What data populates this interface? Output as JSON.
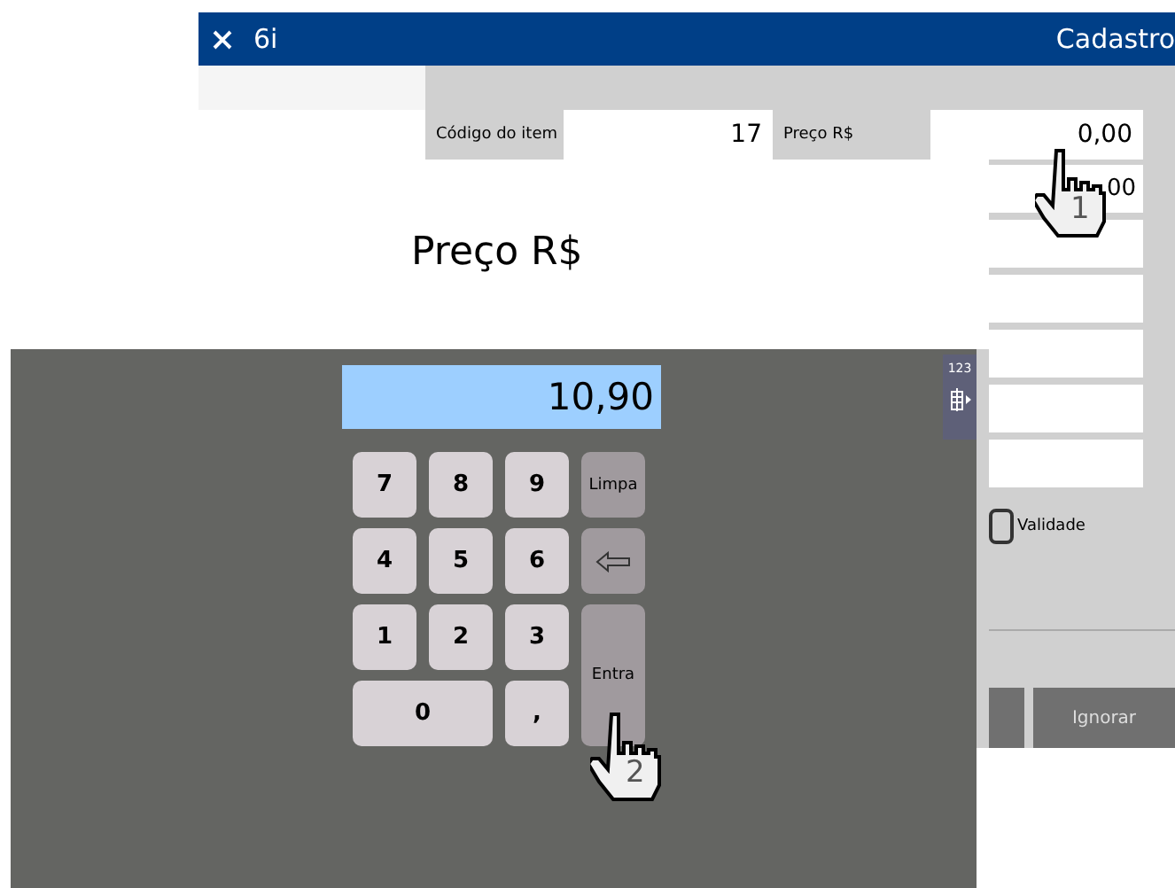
{
  "window": {
    "title": "6i",
    "heading": "Cadastro"
  },
  "form": {
    "fields": [
      {
        "label": "Código do item",
        "value": "17"
      },
      {
        "label": "Preço R$",
        "value": "0,00"
      }
    ],
    "side_field_value": "00",
    "checkbox": {
      "label": "Validade",
      "checked": false
    },
    "buttons": [
      "Ignorar"
    ]
  },
  "prompt": {
    "title": "Preço R$"
  },
  "keypad": {
    "display": "10,90",
    "side_tab": "123",
    "keys": [
      {
        "label": "7",
        "kind": "digit"
      },
      {
        "label": "8",
        "kind": "digit"
      },
      {
        "label": "9",
        "kind": "digit"
      },
      {
        "label": "Limpa",
        "kind": "clear"
      },
      {
        "label": "4",
        "kind": "digit"
      },
      {
        "label": "5",
        "kind": "digit"
      },
      {
        "label": "6",
        "kind": "digit"
      },
      {
        "kind": "backspace"
      },
      {
        "label": "1",
        "kind": "digit"
      },
      {
        "label": "2",
        "kind": "digit"
      },
      {
        "label": "3",
        "kind": "digit"
      },
      {
        "label": "Entra",
        "kind": "enter"
      },
      {
        "label": "0",
        "kind": "wide"
      },
      {
        "label": ",",
        "kind": "digit"
      }
    ]
  },
  "cursors": [
    {
      "label": "1"
    },
    {
      "label": "2"
    }
  ]
}
